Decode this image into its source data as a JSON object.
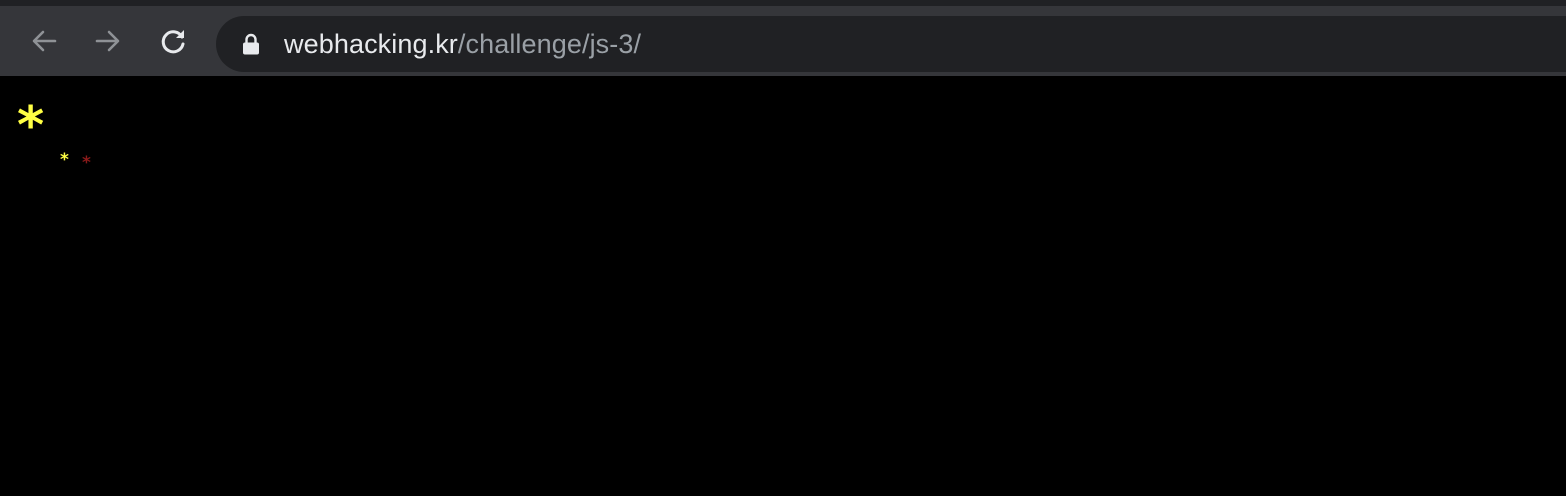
{
  "browser": {
    "url_host": "webhacking.kr",
    "url_path": "/challenge/js-3/",
    "icons": {
      "back": "arrow-left-icon",
      "forward": "arrow-right-icon",
      "reload": "reload-icon",
      "lock": "lock-icon"
    },
    "colors": {
      "toolbar_bg": "#35363a",
      "omnibox_bg": "#202124",
      "host_text": "#e8eaed",
      "path_text": "#9aa0a6"
    }
  },
  "page": {
    "background": "#000000",
    "stars": [
      {
        "glyph": "*",
        "color": "#ffff44"
      },
      {
        "glyph": "*",
        "color": "#ffff44"
      },
      {
        "glyph": "*",
        "color": "#8b1a1a"
      }
    ]
  }
}
